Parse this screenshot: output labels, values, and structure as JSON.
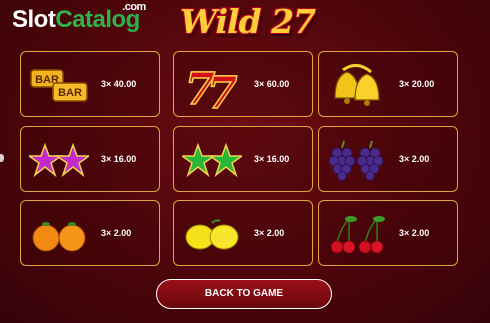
{
  "watermark": {
    "slot": "Slot",
    "catalog": "Catalog",
    "com": ".com"
  },
  "game_title": "Wild 27",
  "paytable": [
    {
      "symbol": "bar-icon",
      "pay": "3× 40.00"
    },
    {
      "symbol": "seven-icon",
      "pay": "3× 60.00"
    },
    {
      "symbol": "bells-icon",
      "pay": "3× 20.00"
    },
    {
      "symbol": "purple-stars-icon",
      "pay": "3× 16.00"
    },
    {
      "symbol": "green-stars-icon",
      "pay": "3× 16.00"
    },
    {
      "symbol": "grapes-icon",
      "pay": "3× 2.00"
    },
    {
      "symbol": "oranges-icon",
      "pay": "3× 2.00"
    },
    {
      "symbol": "lemons-icon",
      "pay": "3× 2.00"
    },
    {
      "symbol": "cherries-icon",
      "pay": "3× 2.00"
    }
  ],
  "bar_text": "BAR",
  "seven_text": "7",
  "back_button": "BACK TO GAME",
  "colors": {
    "border": "#e3a43a",
    "background": "#5a070c",
    "title": "#ffcf3a",
    "catalog_green": "#2fb24a"
  }
}
